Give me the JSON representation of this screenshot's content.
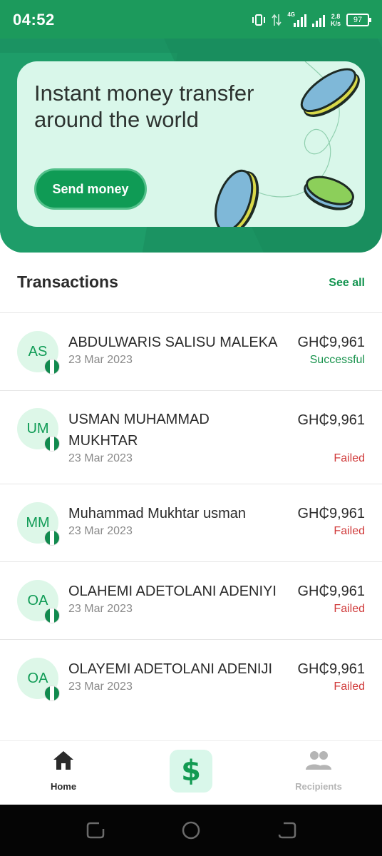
{
  "status_bar": {
    "time": "04:52",
    "network": "4G",
    "speed_value": "2.8",
    "speed_unit": "K/s",
    "battery": "97"
  },
  "promo": {
    "title": "Instant money transfer around the world",
    "button_label": "Send money"
  },
  "transactions": {
    "title": "Transactions",
    "see_all_label": "See all",
    "items": [
      {
        "initials": "AS",
        "name": "ABDULWARIS SALISU MALEKA",
        "date": "23 Mar 2023",
        "amount": "GH₵9,961",
        "status": "Successful"
      },
      {
        "initials": "UM",
        "name": "USMAN MUHAMMAD MUKHTAR",
        "date": "23 Mar 2023",
        "amount": "GH₵9,961",
        "status": "Failed"
      },
      {
        "initials": "MM",
        "name": "Muhammad Mukhtar usman",
        "date": "23 Mar 2023",
        "amount": "GH₵9,961",
        "status": "Failed"
      },
      {
        "initials": "OA",
        "name": "OLAHEMI ADETOLANI ADENIYI",
        "date": "23 Mar 2023",
        "amount": "GH₵9,961",
        "status": "Failed"
      },
      {
        "initials": "OA",
        "name": "OLAYEMI ADETOLANI ADENIJI",
        "date": "23 Mar 2023",
        "amount": "GH₵9,961",
        "status": "Failed"
      }
    ]
  },
  "bottom_nav": {
    "home_label": "Home",
    "recipients_label": "Recipients",
    "center_symbol": "$"
  },
  "colors": {
    "brand_green": "#1b9362",
    "success": "#19934d",
    "failed": "#d03a3a",
    "card_bg": "#d9f7ea"
  }
}
